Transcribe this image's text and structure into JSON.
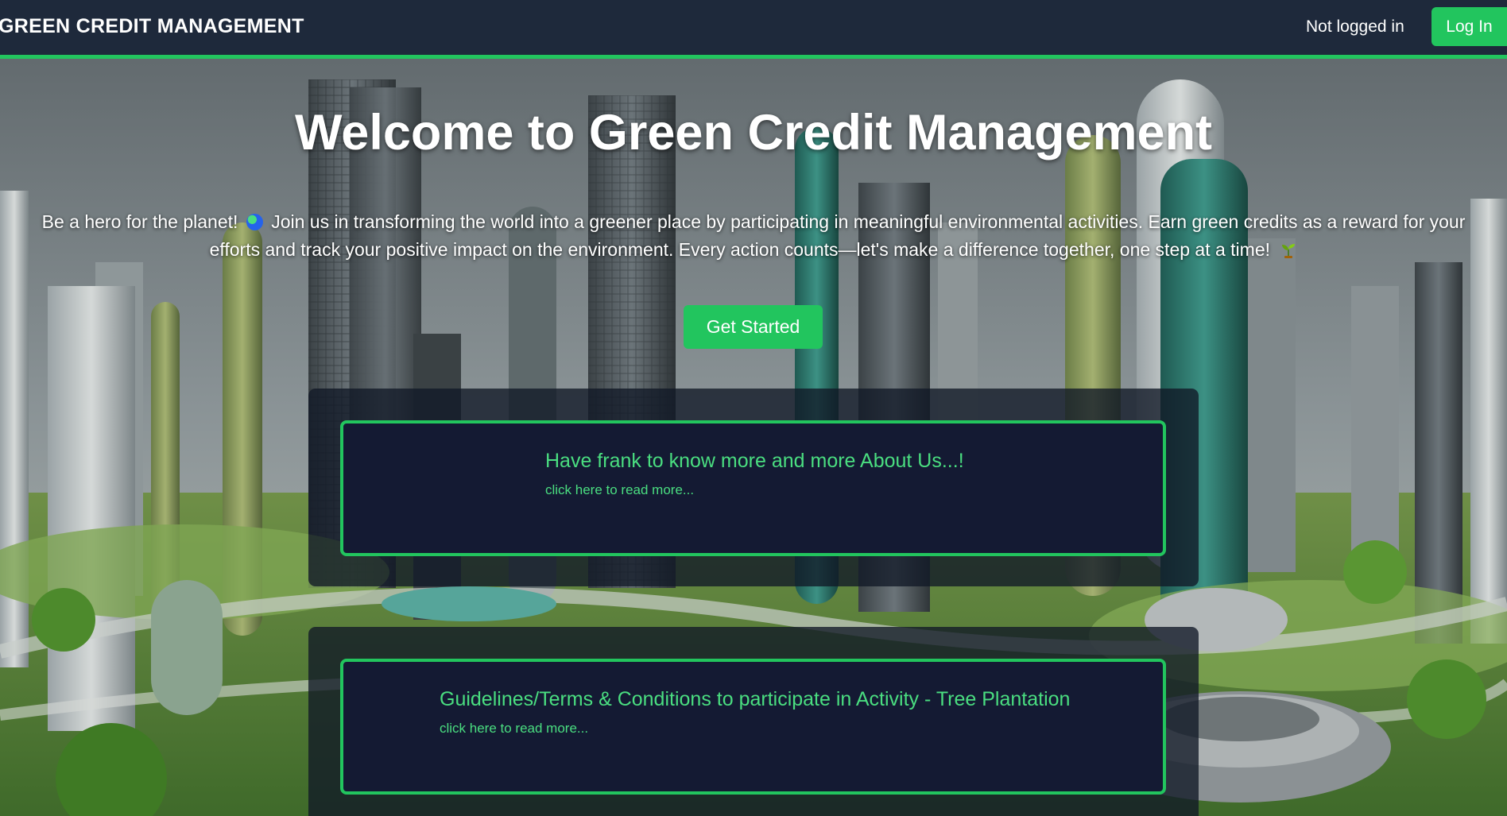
{
  "navbar": {
    "brand": "GREEN CREDIT MANAGEMENT",
    "login_status": "Not logged in",
    "login_button": "Log In"
  },
  "hero": {
    "title": "Welcome to Green Credit Management",
    "text_part1": "Be a hero for the planet!",
    "text_part2": "Join us in transforming the world into a greener place by participating in meaningful environmental activities. Earn green credits as a reward for your efforts and track your positive impact on the environment. Every action counts—let's make a difference together, one step at a time!",
    "cta_button": "Get Started"
  },
  "cards": [
    {
      "title": "Have frank to know more and more About Us...!",
      "link": "click here to read more..."
    },
    {
      "title": "Guidelines/Terms & Conditions to participate in Activity - Tree Plantation",
      "link": "click here to read more..."
    }
  ],
  "icons": {
    "globe": "globe-emoji-icon",
    "sprout": "seedling-emoji-icon"
  },
  "colors": {
    "accent": "#22c55e",
    "navbar_bg": "#1e293b",
    "card_bg": "#141a33",
    "card_text": "#4ade80"
  }
}
